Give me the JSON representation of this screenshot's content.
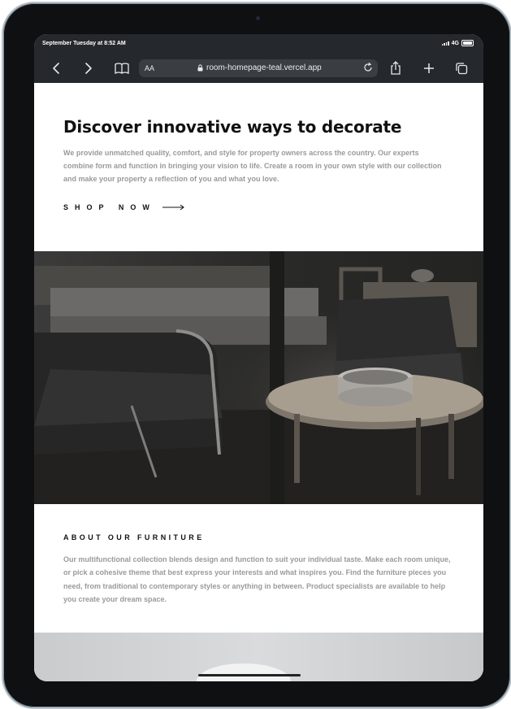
{
  "status": {
    "time": "September Tuesday at 8:52 AM",
    "network": "4G"
  },
  "browser": {
    "text_size": "AA",
    "url": "room-homepage-teal.vercel.app",
    "icons": [
      "back-icon",
      "forward-icon",
      "bookmarks-icon",
      "lock-icon",
      "reload-icon",
      "share-icon",
      "new-tab-icon",
      "tabs-icon"
    ]
  },
  "hero": {
    "title": "Discover innovative ways to decorate",
    "description": "We provide unmatched quality, comfort, and style for property owners across the country. Our experts combine form and function in bringing your vision to life. Create a room in your own style with our collection and make your property a reflection of you and what you love.",
    "cta_label": "SHOP NOW"
  },
  "about": {
    "title": "ABOUT OUR FURNITURE",
    "description": "Our multifunctional collection blends design and function to suit your individual taste. Make each room unique, or pick a cohesive theme that best express your interests and what inspires you. Find the furniture pieces you need, from traditional to contemporary styles or anything in between. Product specialists are available to help you create your dream space."
  },
  "colors": {
    "browser_chrome": "#25282c",
    "url_field": "#3a3e43",
    "heading": "#111111",
    "body_text": "#9a9a9a",
    "device_bezel": "#0f1012"
  }
}
